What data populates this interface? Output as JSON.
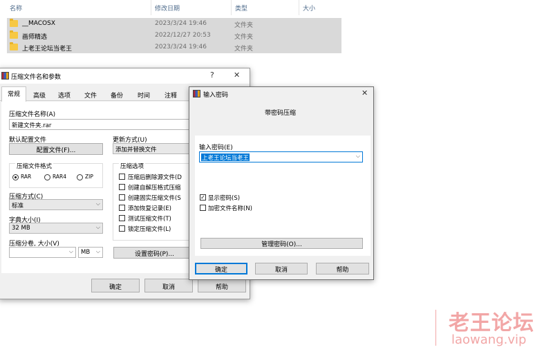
{
  "explorer": {
    "columns": [
      "名称",
      "修改日期",
      "类型",
      "大小"
    ],
    "rows": [
      {
        "name": "__MACOSX",
        "date": "2023/3/24 19:46",
        "type": "文件夹"
      },
      {
        "name": "画师精选",
        "date": "2022/12/27 20:53",
        "type": "文件夹"
      },
      {
        "name": "上老王论坛当老王",
        "date": "2023/3/24 19:46",
        "type": "文件夹"
      }
    ]
  },
  "archive_dialog": {
    "title": "压缩文件名和参数",
    "help_glyph": "?",
    "close_glyph": "✕",
    "tabs": [
      "常规",
      "高级",
      "选项",
      "文件",
      "备份",
      "时间",
      "注释"
    ],
    "archive_name_label": "压缩文件名称(A)",
    "archive_name_value": "新建文件夹.rar",
    "default_profile_label": "默认配置文件",
    "profile_button": "配置文件(F)...",
    "update_mode_label": "更新方式(U)",
    "update_mode_value": "添加并替换文件",
    "format_group_label": "压缩文件格式",
    "formats": [
      "RAR",
      "RAR4",
      "ZIP"
    ],
    "selected_format": "RAR",
    "method_label": "压缩方式(C)",
    "method_value": "标准",
    "dict_label": "字典大小(I)",
    "dict_value": "32 MB",
    "split_label": "压缩分卷, 大小(V)",
    "split_value": "",
    "split_unit": "MB",
    "options_group_label": "压缩选项",
    "options": [
      {
        "label": "压缩后删除源文件(D",
        "checked": false
      },
      {
        "label": "创建自解压格式压缩",
        "checked": false
      },
      {
        "label": "创建固实压缩文件(S",
        "checked": false
      },
      {
        "label": "添加恢复记录(E)",
        "checked": false
      },
      {
        "label": "测试压缩文件(T)",
        "checked": false
      },
      {
        "label": "锁定压缩文件(L)",
        "checked": false
      }
    ],
    "set_password_button": "设置密码(P)...",
    "ok": "确定",
    "cancel": "取消",
    "help": "帮助"
  },
  "password_dialog": {
    "title": "输入密码",
    "close_glyph": "✕",
    "heading": "带密码压缩",
    "password_label": "输入密码(E)",
    "password_value": "上老王论坛当老王",
    "show_password": {
      "label": "显示密码(S)",
      "checked": true
    },
    "encrypt_names": {
      "label": "加密文件名称(N)",
      "checked": false
    },
    "manage_button": "管理密码(O)...",
    "ok": "确定",
    "cancel": "取消",
    "help": "帮助"
  },
  "watermark": {
    "cn": "老王论坛",
    "url": "laowang.vip"
  },
  "colors": {
    "accent": "#0078d7",
    "folder": "#f7c843",
    "watermark": "#f2a6a6"
  }
}
